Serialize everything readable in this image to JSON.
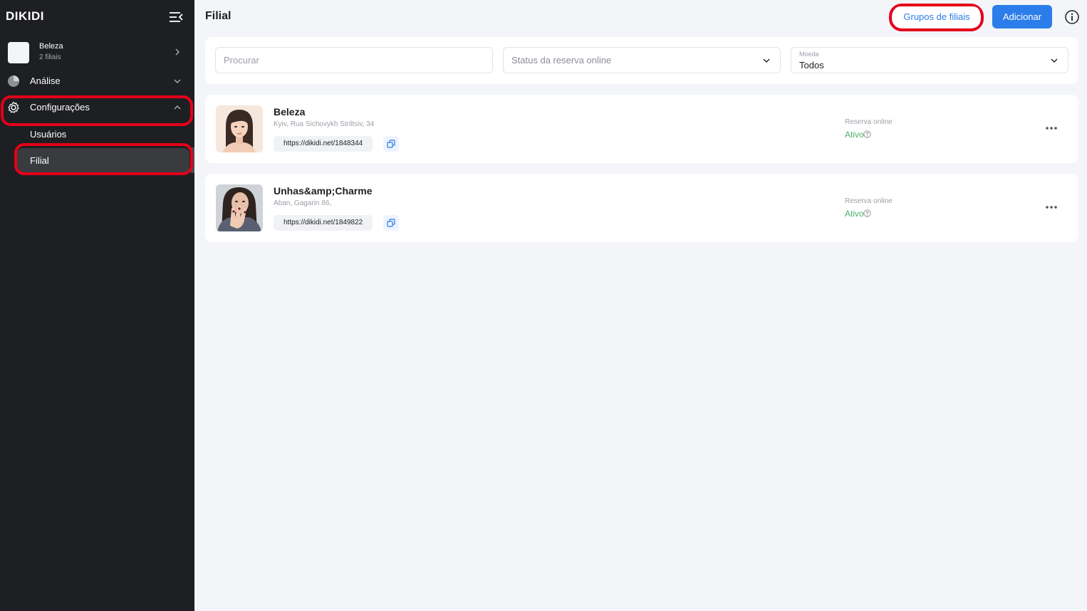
{
  "app": {
    "logo": "DIKIDI"
  },
  "sidebar": {
    "account": {
      "name": "Beleza",
      "subtitle": "2 filiais"
    },
    "nav": [
      {
        "label": "Análise",
        "icon": "pie-chart-icon"
      },
      {
        "label": "Configurações",
        "icon": "gear-icon"
      }
    ],
    "subnav": [
      {
        "label": "Usuários",
        "active": false
      },
      {
        "label": "Filial",
        "active": true
      }
    ]
  },
  "header": {
    "title": "Filial",
    "groups_button": "Grupos de filiais",
    "add_button": "Adicionar"
  },
  "filters": {
    "search_placeholder": "Procurar",
    "status_placeholder": "Status da reserva online",
    "currency_label": "Moeda",
    "currency_value": "Todos"
  },
  "branches": [
    {
      "name": "Beleza",
      "address": "Kyiv, Rua Sichovykh Striltsiv, 34",
      "link": "https://dikidi.net/1848344",
      "reservation_label": "Reserva online",
      "reservation_status": "Ativo"
    },
    {
      "name": "Unhas&amp;Charme",
      "address": "Aban, Gagarin 86,",
      "link": "https://dikidi.net/1849822",
      "reservation_label": "Reserva online",
      "reservation_status": "Ativo"
    }
  ],
  "colors": {
    "sidebar_bg": "#1e1f22",
    "accent_blue": "#2b7de9",
    "status_green": "#4caf6a",
    "highlight_red": "#e5001a"
  }
}
